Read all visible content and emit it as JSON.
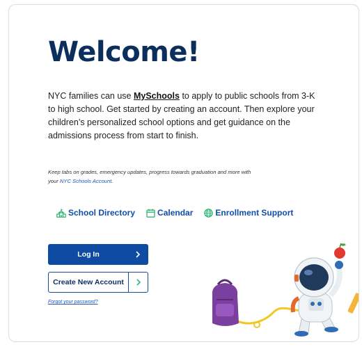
{
  "welcome": {
    "title": "Welcome!",
    "intro_before": "NYC families can use ",
    "intro_link": "MySchools",
    "intro_after": " to apply to public schools from 3-K to high school. Get started by creating an account. Then explore your children’s personalized school options and get guidance on the admissions process from start to finish.",
    "tagline_before": "Keep tabs on grades, emergency updates, progress towards graduation and more with your ",
    "tagline_link": "NYC Schools Account",
    "tagline_after": "."
  },
  "quick_links": [
    {
      "label": "School Directory",
      "icon": "school-icon"
    },
    {
      "label": "Calendar",
      "icon": "calendar-icon"
    },
    {
      "label": "Enrollment Support",
      "icon": "globe-icon"
    }
  ],
  "actions": {
    "login_label": "Log In",
    "create_label": "Create New Account",
    "forgot_label": "Forgot your password?"
  },
  "colors": {
    "brand_navy": "#0c2e5c",
    "primary_blue": "#0f4aa3",
    "link_blue": "#0e4fa8",
    "icon_green": "#2bb673"
  }
}
